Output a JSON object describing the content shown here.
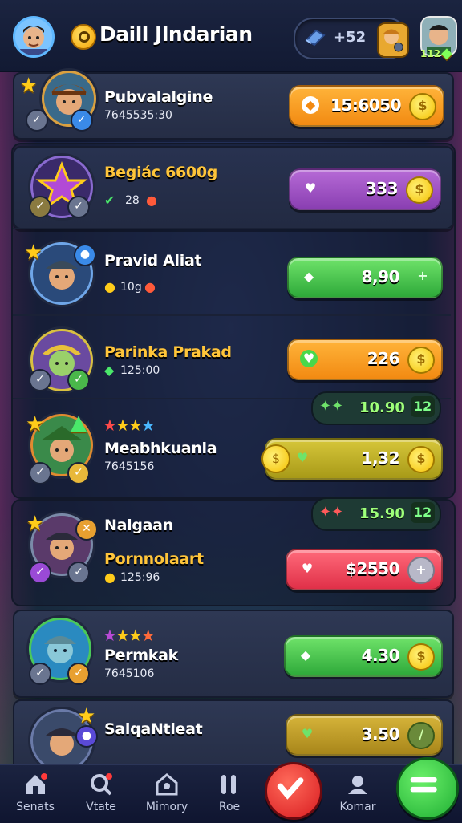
{
  "header": {
    "title": "Daill Jlndarian",
    "currency_value": "+52",
    "level_badge": "112"
  },
  "players": [
    {
      "name": "Pubvalalgine",
      "sub": "7645535:30",
      "value": "15:6050",
      "color": "orange"
    },
    {
      "name": "Begiác 6600g",
      "sub": "28",
      "value": "333",
      "color": "purple"
    },
    {
      "name": "Pravid Aliat",
      "sub": "10g",
      "value": "8,90",
      "color": "green"
    },
    {
      "name": "Parinka Prakad",
      "sub": "125:00",
      "value": "226",
      "color": "orange"
    },
    {
      "name": "Meabhkuanla",
      "sub": "7645156",
      "value": "1,32",
      "color": "olive",
      "pill": "10.90",
      "pill_badge": "12"
    },
    {
      "name": "Nalgaan",
      "name2": "Pornnolaart",
      "sub": "125:96",
      "value": "$2550",
      "color": "red",
      "pill": "15.90",
      "pill_badge": "12"
    },
    {
      "name": "Permkak",
      "sub": "7645106",
      "value": "4.30",
      "color": "green"
    },
    {
      "name": "SalqaNtleat",
      "sub": "",
      "value": "3.50",
      "color": "gold"
    }
  ],
  "nav": {
    "items": [
      "Senats",
      "Vtate",
      "Mimory",
      "Roe",
      "Komar"
    ]
  },
  "colors": {
    "accent_green": "#2ea93a",
    "accent_red": "#e03048",
    "accent_orange": "#f28a12",
    "background": "#1a2344"
  }
}
